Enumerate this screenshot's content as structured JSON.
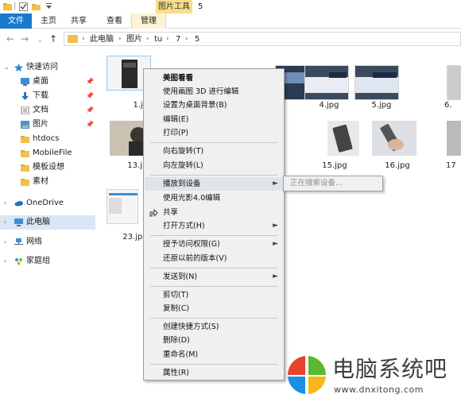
{
  "window": {
    "title": "5",
    "tools_tab": "图片工具"
  },
  "ribbon": {
    "tabs": [
      {
        "label": "文件"
      },
      {
        "label": "主页"
      },
      {
        "label": "共享"
      },
      {
        "label": "查看"
      },
      {
        "label": "管理"
      }
    ]
  },
  "address": {
    "crumbs": [
      "此电脑",
      "图片",
      "tu",
      "7",
      "5"
    ]
  },
  "nav": {
    "quick_access": "快速访问",
    "items": [
      {
        "label": "桌面"
      },
      {
        "label": "下载"
      },
      {
        "label": "文档"
      },
      {
        "label": "图片"
      },
      {
        "label": "htdocs"
      },
      {
        "label": "MobileFile"
      },
      {
        "label": "模板设想"
      },
      {
        "label": "素材"
      }
    ],
    "onedrive": "OneDrive",
    "this_pc": "此电脑",
    "network": "网络",
    "homegroup": "家庭组"
  },
  "files": [
    {
      "name": "1.jpg"
    },
    {
      "name": "4.jpg"
    },
    {
      "name": "5.jpg"
    },
    {
      "name": "6."
    },
    {
      "name": "13.jpg"
    },
    {
      "name": "15.jpg"
    },
    {
      "name": "16.jpg"
    },
    {
      "name": "17"
    },
    {
      "name": "23.jpg"
    }
  ],
  "context_menu": {
    "items": [
      {
        "label": "美图看看"
      },
      {
        "label": "使用画图 3D 进行编辑"
      },
      {
        "label": "设置为桌面背景(B)"
      },
      {
        "label": "编辑(E)"
      },
      {
        "label": "打印(P)"
      },
      {
        "label": "向右旋转(T)"
      },
      {
        "label": "向左旋转(L)"
      },
      {
        "label": "播放到设备"
      },
      {
        "label": "使用光影4.0编辑"
      },
      {
        "label": "共享"
      },
      {
        "label": "打开方式(H)"
      },
      {
        "label": "授予访问权限(G)"
      },
      {
        "label": "还原以前的版本(V)"
      },
      {
        "label": "发送到(N)"
      },
      {
        "label": "剪切(T)"
      },
      {
        "label": "复制(C)"
      },
      {
        "label": "创建快捷方式(S)"
      },
      {
        "label": "删除(D)"
      },
      {
        "label": "重命名(M)"
      },
      {
        "label": "属性(R)"
      }
    ],
    "submenu": {
      "label": "正在搜索设备..."
    }
  },
  "watermark": {
    "brand": "电脑系统吧",
    "url": "www.dnxitong.com"
  },
  "colors": {
    "file_tab": "#1979ca",
    "tools_tab": "#f8dd8c",
    "selection": "#d9e6f5",
    "folder": "#f2c04b"
  }
}
